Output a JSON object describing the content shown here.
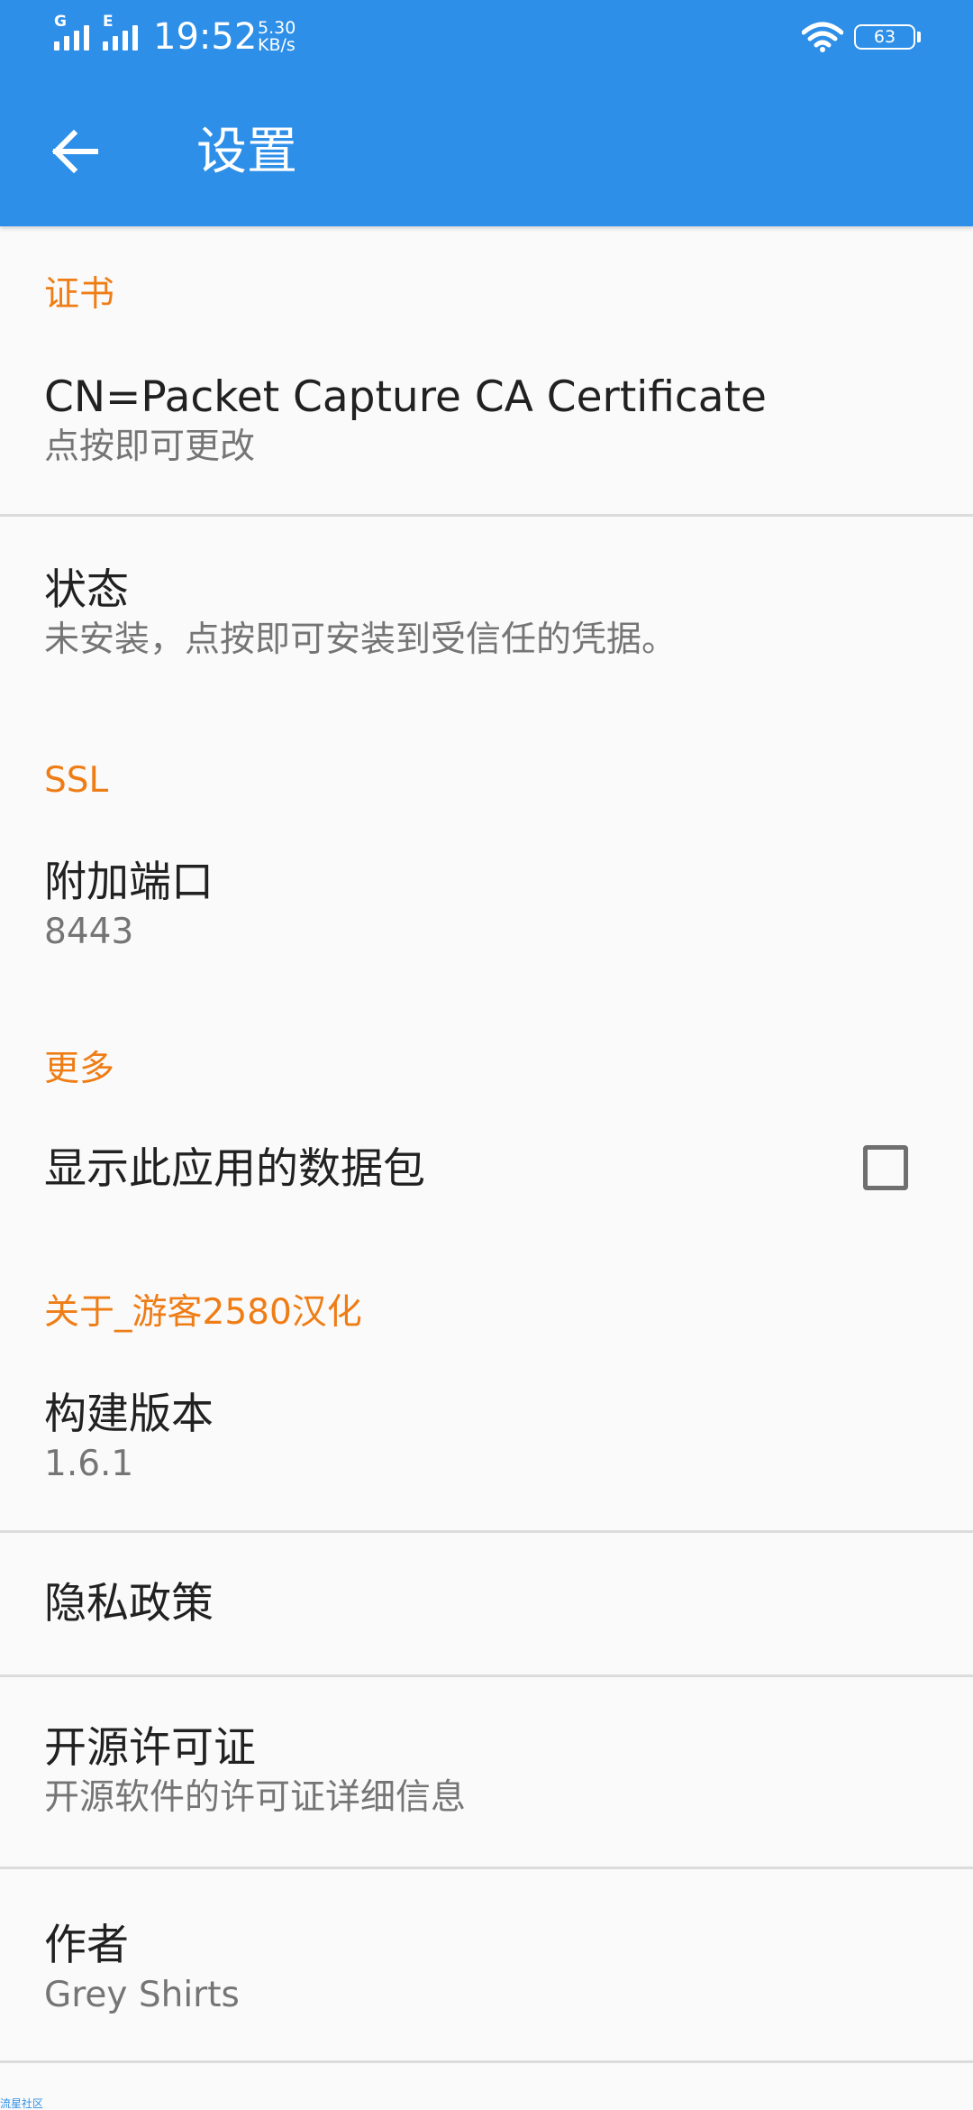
{
  "status_bar": {
    "network_1": "G",
    "network_2": "E",
    "time": "19:52",
    "speed_value": "5.30",
    "speed_unit": "KB/s",
    "wifi_icon": "wifi-icon",
    "battery_level": "63"
  },
  "toolbar": {
    "back_icon": "arrow-left-icon",
    "title": "设置",
    "background": "#2d8fe8"
  },
  "sections": {
    "certificate": {
      "header": "证书",
      "cn_title": "CN=Packet Capture CA Certificate",
      "cn_summary": "点按即可更改",
      "status_title": "状态",
      "status_summary": "未安装，点按即可安装到受信任的凭据。"
    },
    "ssl": {
      "header": "SSL",
      "port_title": "附加端口",
      "port_summary": "8443"
    },
    "more": {
      "header": "更多",
      "show_packets_title": "显示此应用的数据包",
      "show_packets_checked": false
    },
    "about": {
      "header": "关于_游客2580汉化",
      "build_title": "构建版本",
      "build_summary": "1.6.1",
      "privacy_title": "隐私政策",
      "license_title": "开源许可证",
      "license_summary": "开源软件的许可证详细信息",
      "author_title": "作者",
      "author_summary": "Grey Shirts"
    }
  },
  "watermark": "流星社区",
  "colors": {
    "accent": "#ef7d16",
    "primary": "#2d8fe8"
  }
}
